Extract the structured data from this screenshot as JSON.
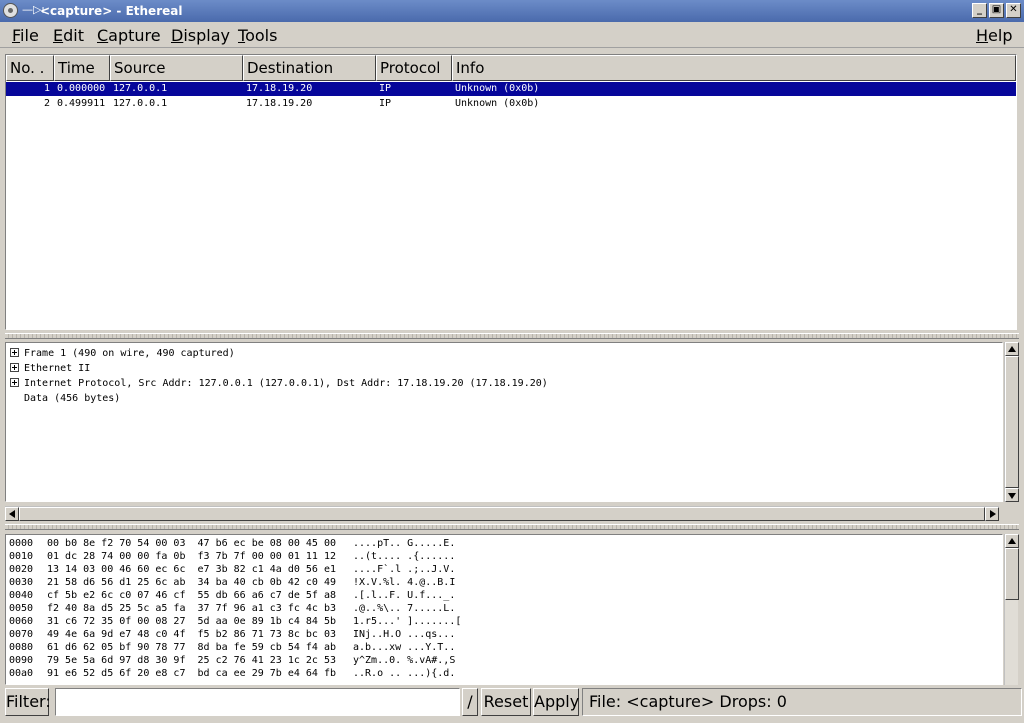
{
  "window": {
    "title": "<capture> - Ethereal",
    "pin_glyph": "—▷ı",
    "btn_min": "_",
    "btn_max": "▣",
    "btn_close": "✕"
  },
  "menu": {
    "file": {
      "u": "F",
      "rest": "ile"
    },
    "edit": {
      "u": "E",
      "rest": "dit"
    },
    "capture": {
      "u": "C",
      "rest": "apture"
    },
    "display": {
      "u": "D",
      "rest": "isplay"
    },
    "tools": {
      "u": "T",
      "rest": "ools"
    },
    "help": {
      "u": "H",
      "rest": "elp"
    }
  },
  "packet_list": {
    "columns": [
      "No. .",
      "Time",
      "Source",
      "Destination",
      "Protocol",
      "Info"
    ],
    "rows": [
      {
        "no": "1",
        "time": "0.000000",
        "source": "127.0.0.1",
        "destination": "17.18.19.20",
        "protocol": "IP",
        "info": "Unknown (0x0b)"
      },
      {
        "no": "2",
        "time": "0.499911",
        "source": "127.0.0.1",
        "destination": "17.18.19.20",
        "protocol": "IP",
        "info": "Unknown (0x0b)"
      }
    ]
  },
  "tree": {
    "items": [
      "Frame 1 (490 on wire, 490 captured)",
      "Ethernet II",
      "Internet Protocol, Src Addr: 127.0.0.1 (127.0.0.1), Dst Addr: 17.18.19.20 (17.18.19.20)",
      "Data (456 bytes)"
    ]
  },
  "hex": {
    "rows": [
      {
        "off": "0000",
        "hex": "00 b0 8e f2 70 54 00 03  47 b6 ec be 08 00 45 00",
        "ascii": "....pT.. G.....E."
      },
      {
        "off": "0010",
        "hex": "01 dc 28 74 00 00 fa 0b  f3 7b 7f 00 00 01 11 12",
        "ascii": "..(t.... .{......"
      },
      {
        "off": "0020",
        "hex": "13 14 03 00 46 60 ec 6c  e7 3b 82 c1 4a d0 56 e1",
        "ascii": "....F`.l .;..J.V."
      },
      {
        "off": "0030",
        "hex": "21 58 d6 56 d1 25 6c ab  34 ba 40 cb 0b 42 c0 49",
        "ascii": "!X.V.%l. 4.@..B.I"
      },
      {
        "off": "0040",
        "hex": "cf 5b e2 6c c0 07 46 cf  55 db 66 a6 c7 de 5f a8",
        "ascii": ".[.l..F. U.f..._."
      },
      {
        "off": "0050",
        "hex": "f2 40 8a d5 25 5c a5 fa  37 7f 96 a1 c3 fc 4c b3",
        "ascii": ".@..%\\.. 7.....L."
      },
      {
        "off": "0060",
        "hex": "31 c6 72 35 0f 00 08 27  5d aa 0e 89 1b c4 84 5b",
        "ascii": "1.r5...' ].......["
      },
      {
        "off": "0070",
        "hex": "49 4e 6a 9d e7 48 c0 4f  f5 b2 86 71 73 8c bc 03",
        "ascii": "INj..H.O ...qs..."
      },
      {
        "off": "0080",
        "hex": "61 d6 62 05 bf 90 78 77  8d ba fe 59 cb 54 f4 ab",
        "ascii": "a.b...xw ...Y.T.."
      },
      {
        "off": "0090",
        "hex": "79 5e 5a 6d 97 d8 30 9f  25 c2 76 41 23 1c 2c 53",
        "ascii": "y^Zm..0. %.vA#.,S"
      },
      {
        "off": "00a0",
        "hex": "91 e6 52 d5 6f 20 e8 c7  bd ca ee 29 7b e4 64 fb",
        "ascii": "..R.o .. ...){.d."
      }
    ]
  },
  "bottom": {
    "filter_label": "Filter:",
    "filter_value": "",
    "slash": "/",
    "reset": "Reset",
    "apply": "Apply",
    "status": "File: <capture>  Drops: 0"
  }
}
